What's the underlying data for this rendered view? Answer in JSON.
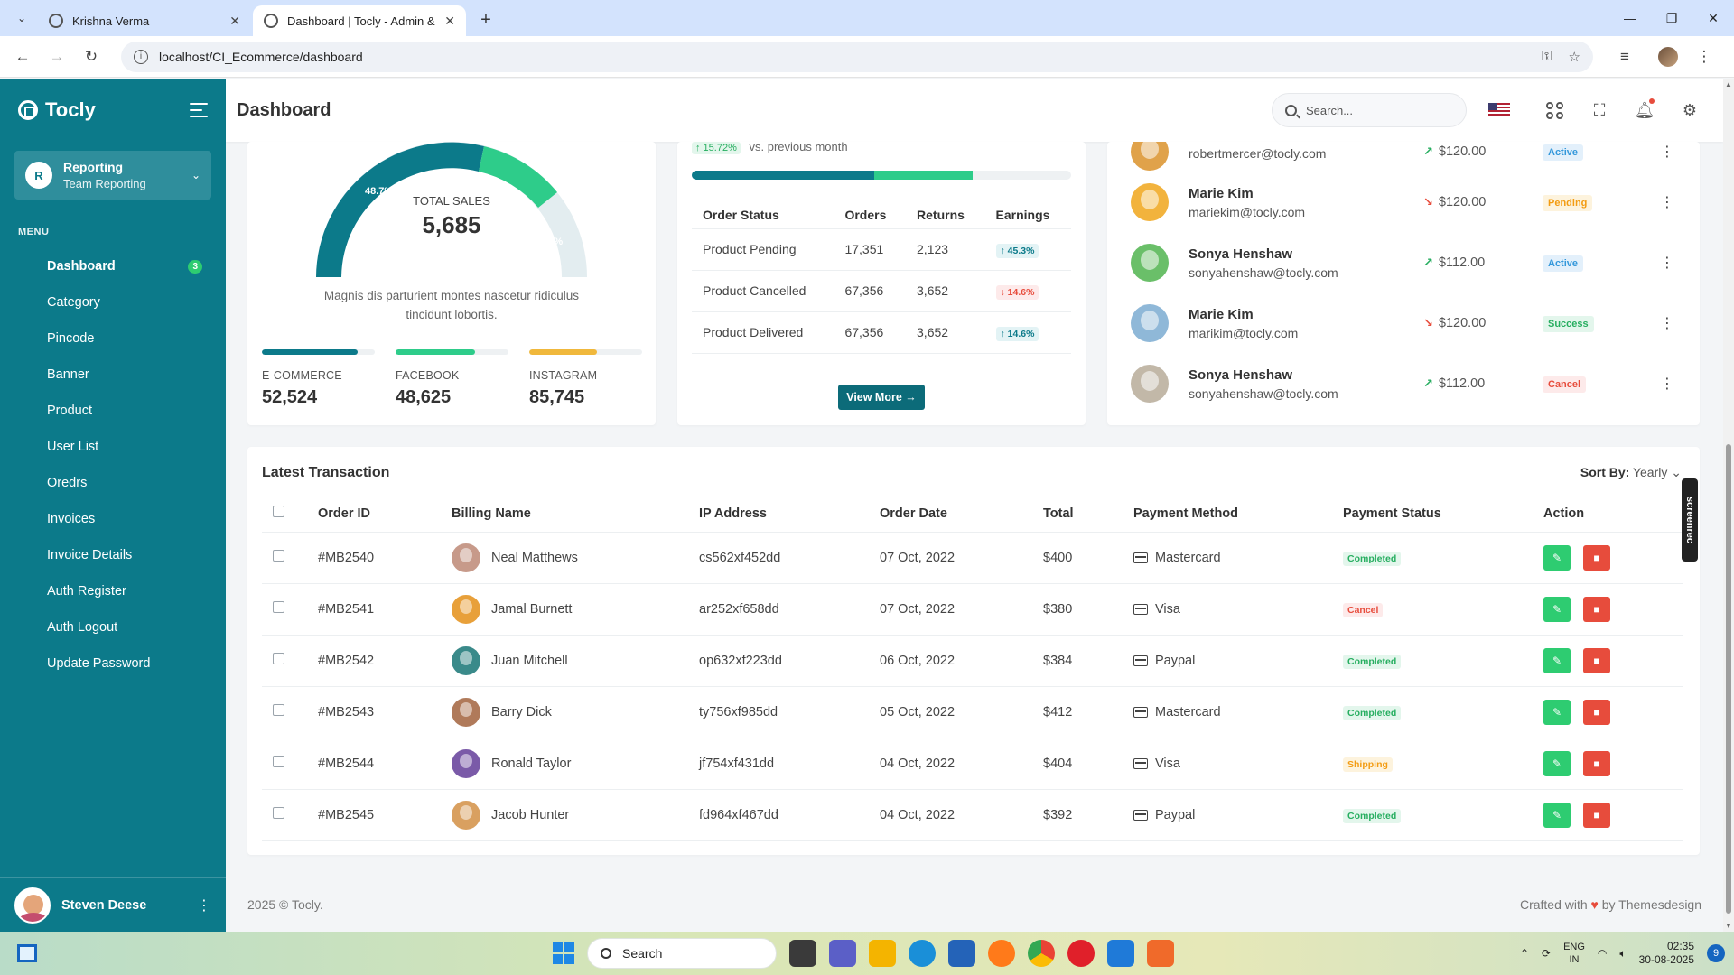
{
  "browser": {
    "tabs": [
      {
        "title": "Krishna Verma",
        "active": false
      },
      {
        "title": "Dashboard | Tocly - Admin & D",
        "active": true
      }
    ],
    "url": "localhost/CI_Ecommerce/dashboard"
  },
  "sidebar": {
    "brand": "Tocly",
    "workspace": {
      "initial": "R",
      "name": "Reporting",
      "sub": "Team Reporting"
    },
    "menu_title": "MENU",
    "items": [
      {
        "label": "Dashboard",
        "badge": "3",
        "active": true
      },
      {
        "label": "Category"
      },
      {
        "label": "Pincode"
      },
      {
        "label": "Banner"
      },
      {
        "label": "Product"
      },
      {
        "label": "User List"
      },
      {
        "label": "Oredrs"
      },
      {
        "label": "Invoices"
      },
      {
        "label": "Invoice Details"
      },
      {
        "label": "Auth Register"
      },
      {
        "label": "Auth Logout"
      },
      {
        "label": "Update Password"
      }
    ],
    "user": {
      "name": "Steven Deese"
    }
  },
  "header": {
    "title": "Dashboard",
    "search_placeholder": "Search..."
  },
  "sales": {
    "gauge_label": "TOTAL SALES",
    "gauge_value": "5,685",
    "segment_labels": [
      "48.7%",
      "20.5%"
    ],
    "description": "Magnis dis parturient montes nascetur ridiculus tincidunt lobortis.",
    "sources": [
      {
        "label": "E-COMMERCE",
        "value": "52,524",
        "fill": 0.85,
        "color": "#0c7a8a"
      },
      {
        "label": "FACEBOOK",
        "value": "48,625",
        "fill": 0.7,
        "color": "#2ecc8a"
      },
      {
        "label": "INSTAGRAM",
        "value": "85,745",
        "fill": 0.6,
        "color": "#f0b83c"
      }
    ]
  },
  "orders": {
    "growth_badge": "↑ 15.72%",
    "growth_text": "vs. previous month",
    "progress": [
      {
        "fill": 0.48,
        "color": "#0c7a8a"
      },
      {
        "fill": 0.26,
        "color": "#2ecc8a"
      }
    ],
    "columns": [
      "Order Status",
      "Orders",
      "Returns",
      "Earnings"
    ],
    "rows": [
      {
        "status": "Product Pending",
        "orders": "17,351",
        "returns": "2,123",
        "earnings": "↑ 45.3%",
        "dir": "up"
      },
      {
        "status": "Product Cancelled",
        "orders": "67,356",
        "returns": "3,652",
        "earnings": "↓ 14.6%",
        "dir": "down"
      },
      {
        "status": "Product Delivered",
        "orders": "67,356",
        "returns": "3,652",
        "earnings": "↑ 14.6%",
        "dir": "up"
      }
    ],
    "view_more": "View More"
  },
  "users": {
    "rows": [
      {
        "name": "",
        "email": "robertmercer@tocly.com",
        "amount": "$120.00",
        "trend": "up",
        "status": "Active",
        "status_class": "st-active",
        "avatar": "#e0a24a"
      },
      {
        "name": "Marie Kim",
        "email": "mariekim@tocly.com",
        "amount": "$120.00",
        "trend": "down",
        "status": "Pending",
        "status_class": "st-pending",
        "avatar": "#f2b33d"
      },
      {
        "name": "Sonya Henshaw",
        "email": "sonyahenshaw@tocly.com",
        "amount": "$112.00",
        "trend": "up",
        "status": "Active",
        "status_class": "st-active",
        "avatar": "#6abf69"
      },
      {
        "name": "Marie Kim",
        "email": "marikim@tocly.com",
        "amount": "$120.00",
        "trend": "down",
        "status": "Success",
        "status_class": "st-success",
        "avatar": "#8fb8d8"
      },
      {
        "name": "Sonya Henshaw",
        "email": "sonyahenshaw@tocly.com",
        "amount": "$112.00",
        "trend": "up",
        "status": "Cancel",
        "status_class": "st-cancel",
        "avatar": "#c2b8a8"
      }
    ]
  },
  "transactions": {
    "title": "Latest Transaction",
    "sort_label": "Sort By:",
    "sort_value": "Yearly",
    "columns": [
      "Order ID",
      "Billing Name",
      "IP Address",
      "Order Date",
      "Total",
      "Payment Method",
      "Payment Status",
      "Action"
    ],
    "rows": [
      {
        "id": "#MB2540",
        "name": "Neal Matthews",
        "ip": "cs562xf452dd",
        "date": "07 Oct, 2022",
        "total": "$400",
        "method": "Mastercard",
        "status": "Completed",
        "status_class": "st-completed",
        "avatar": "#c79a8a"
      },
      {
        "id": "#MB2541",
        "name": "Jamal Burnett",
        "ip": "ar252xf658dd",
        "date": "07 Oct, 2022",
        "total": "$380",
        "method": "Visa",
        "status": "Cancel",
        "status_class": "st-cancel",
        "avatar": "#e8a03a"
      },
      {
        "id": "#MB2542",
        "name": "Juan Mitchell",
        "ip": "op632xf223dd",
        "date": "06 Oct, 2022",
        "total": "$384",
        "method": "Paypal",
        "status": "Completed",
        "status_class": "st-completed",
        "avatar": "#3a8a8a"
      },
      {
        "id": "#MB2543",
        "name": "Barry Dick",
        "ip": "ty756xf985dd",
        "date": "05 Oct, 2022",
        "total": "$412",
        "method": "Mastercard",
        "status": "Completed",
        "status_class": "st-completed",
        "avatar": "#b07a5a"
      },
      {
        "id": "#MB2544",
        "name": "Ronald Taylor",
        "ip": "jf754xf431dd",
        "date": "04 Oct, 2022",
        "total": "$404",
        "method": "Visa",
        "status": "Shipping",
        "status_class": "st-shipping",
        "avatar": "#7a5aa8"
      },
      {
        "id": "#MB2545",
        "name": "Jacob Hunter",
        "ip": "fd964xf467dd",
        "date": "04 Oct, 2022",
        "total": "$392",
        "method": "Paypal",
        "status": "Completed",
        "status_class": "st-completed",
        "avatar": "#d9a060"
      }
    ]
  },
  "footer": {
    "copyright": "2025 © Tocly.",
    "crafted_prefix": "Crafted with",
    "crafted_suffix": "by Themesdesign"
  },
  "screenrec": "screenrec",
  "taskbar": {
    "search": "Search",
    "lang": "ENG",
    "region": "IN",
    "time": "02:35",
    "date": "30-08-2025",
    "notifications": "9"
  }
}
